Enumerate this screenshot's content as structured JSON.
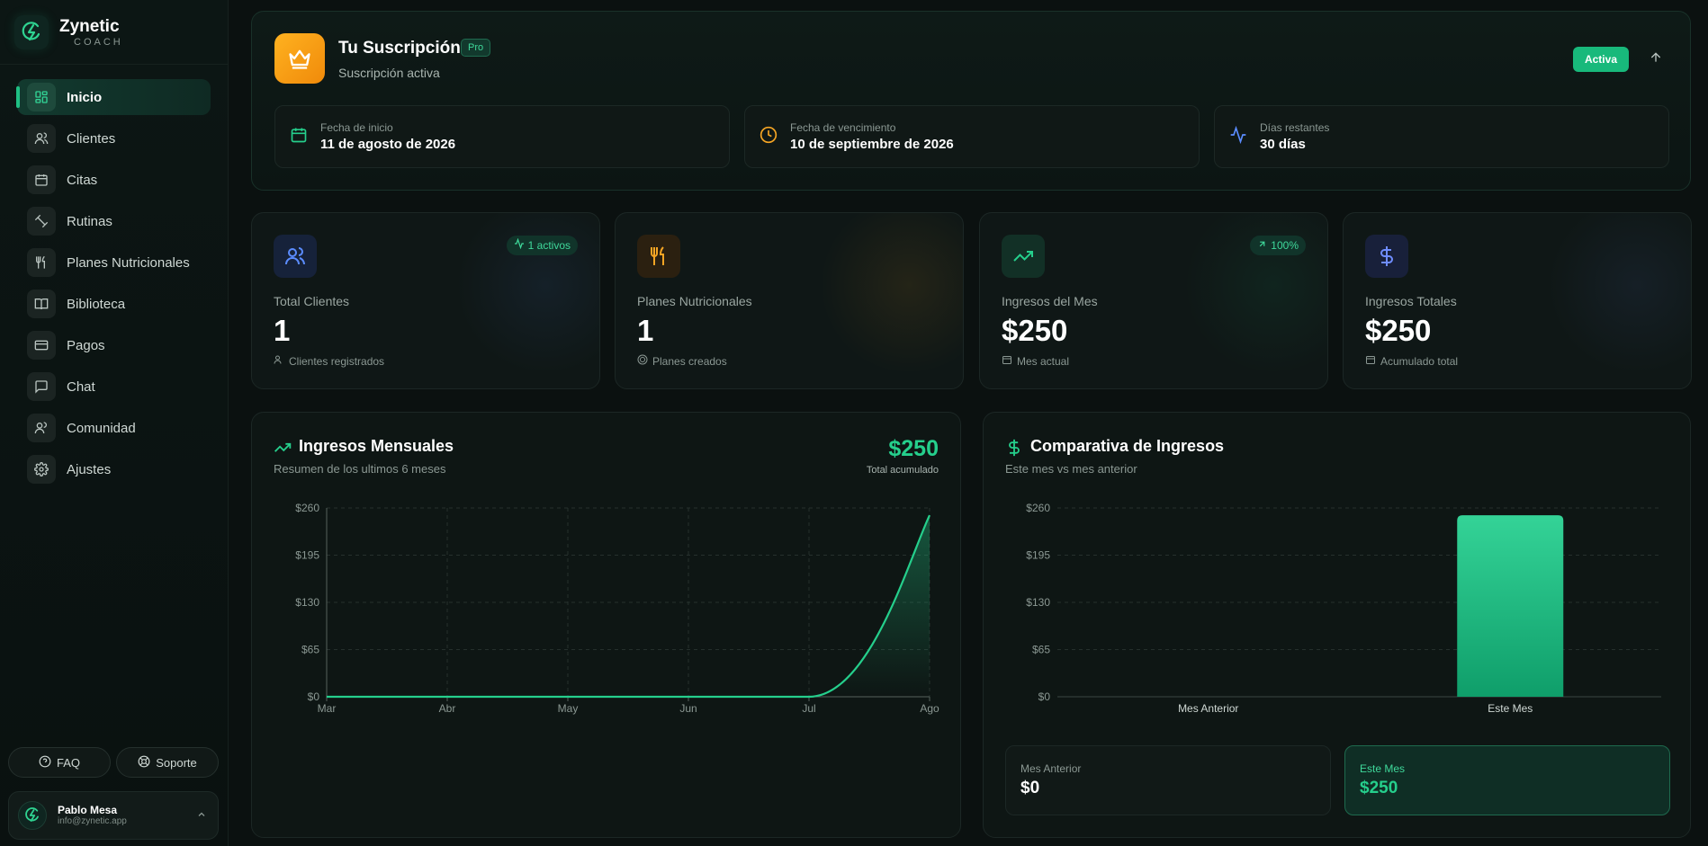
{
  "brand": {
    "name": "Zynetic",
    "sub": "COACH"
  },
  "nav": [
    {
      "label": "Inicio",
      "icon": "grid-icon",
      "active": true
    },
    {
      "label": "Clientes",
      "icon": "users-icon"
    },
    {
      "label": "Citas",
      "icon": "calendar-icon"
    },
    {
      "label": "Rutinas",
      "icon": "dumbbell-icon"
    },
    {
      "label": "Planes Nutricionales",
      "icon": "utensils-icon"
    },
    {
      "label": "Biblioteca",
      "icon": "book-icon"
    },
    {
      "label": "Pagos",
      "icon": "credit-card-icon"
    },
    {
      "label": "Chat",
      "icon": "chat-icon"
    },
    {
      "label": "Comunidad",
      "icon": "community-icon"
    },
    {
      "label": "Ajustes",
      "icon": "gear-icon"
    }
  ],
  "help": {
    "faq": "FAQ",
    "support": "Soporte"
  },
  "user": {
    "name": "Pablo Mesa",
    "email": "info@zynetic.app"
  },
  "subscription": {
    "title": "Tu Suscripción",
    "plan": "Pro",
    "status": "Suscripción activa",
    "badge": "Activa",
    "start_label": "Fecha de inicio",
    "start_value": "11 de agosto de 2026",
    "end_label": "Fecha de vencimiento",
    "end_value": "10 de septiembre de 2026",
    "remaining_label": "Días restantes",
    "remaining_value": "30 días"
  },
  "stats": [
    {
      "label": "Total Clientes",
      "value": "1",
      "foot": "Clientes registrados",
      "badge": "1 activos",
      "color": "#5b8cff"
    },
    {
      "label": "Planes Nutricionales",
      "value": "1",
      "foot": "Planes creados",
      "badge": "",
      "color": "#f5a524"
    },
    {
      "label": "Ingresos del Mes",
      "value": "$250",
      "foot": "Mes actual",
      "badge": "100%",
      "color": "#25cf8c"
    },
    {
      "label": "Ingresos Totales",
      "value": "$250",
      "foot": "Acumulado total",
      "badge": "",
      "color": "#6f8dff"
    }
  ],
  "monthly": {
    "title": "Ingresos Mensuales",
    "subtitle": "Resumen de los ultimos 6 meses",
    "total": "$250",
    "total_label": "Total acumulado"
  },
  "comparison": {
    "title": "Comparativa de Ingresos",
    "subtitle": "Este mes vs mes anterior",
    "prev_label": "Mes Anterior",
    "prev_value": "$0",
    "curr_label": "Este Mes",
    "curr_value": "$250"
  },
  "chart_data": [
    {
      "type": "area",
      "categories": [
        "Mar",
        "Abr",
        "May",
        "Jun",
        "Jul",
        "Ago"
      ],
      "values": [
        0,
        0,
        0,
        0,
        0,
        250
      ],
      "ylim": [
        0,
        260
      ],
      "yticks": [
        "$0",
        "$65",
        "$130",
        "$195",
        "$260"
      ],
      "grid": true,
      "color": "#25cf8c"
    },
    {
      "type": "bar",
      "categories": [
        "Mes Anterior",
        "Este Mes"
      ],
      "values": [
        0,
        250
      ],
      "ylim": [
        0,
        260
      ],
      "yticks": [
        "$0",
        "$65",
        "$130",
        "$195",
        "$260"
      ],
      "grid": true,
      "color": "#25cf8c"
    }
  ]
}
